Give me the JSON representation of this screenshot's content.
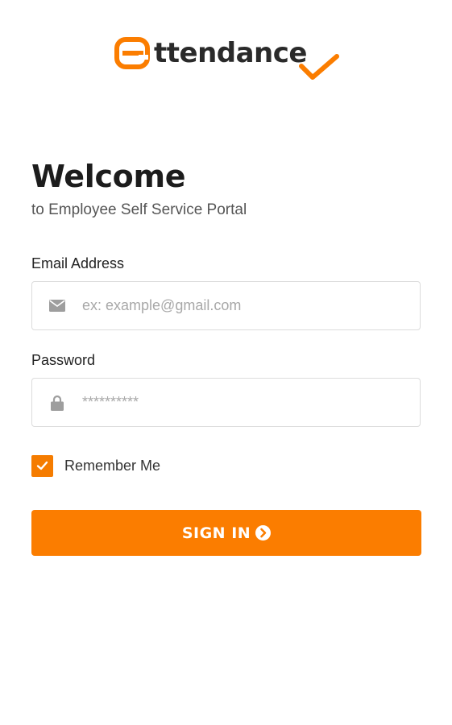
{
  "brand": {
    "logo_text": "ttendance",
    "accent_color": "#fb7d00"
  },
  "welcome": {
    "title": "Welcome",
    "subtitle": "to Employee Self Service Portal"
  },
  "form": {
    "email": {
      "label": "Email Address",
      "placeholder": "ex: example@gmail.com",
      "value": "",
      "icon": "envelope-icon"
    },
    "password": {
      "label": "Password",
      "placeholder": "**********",
      "value": "",
      "icon": "lock-icon"
    },
    "remember": {
      "label": "Remember Me",
      "checked": true
    },
    "submit": {
      "label": "SIGN IN",
      "icon": "arrow-circle-right-icon"
    }
  }
}
